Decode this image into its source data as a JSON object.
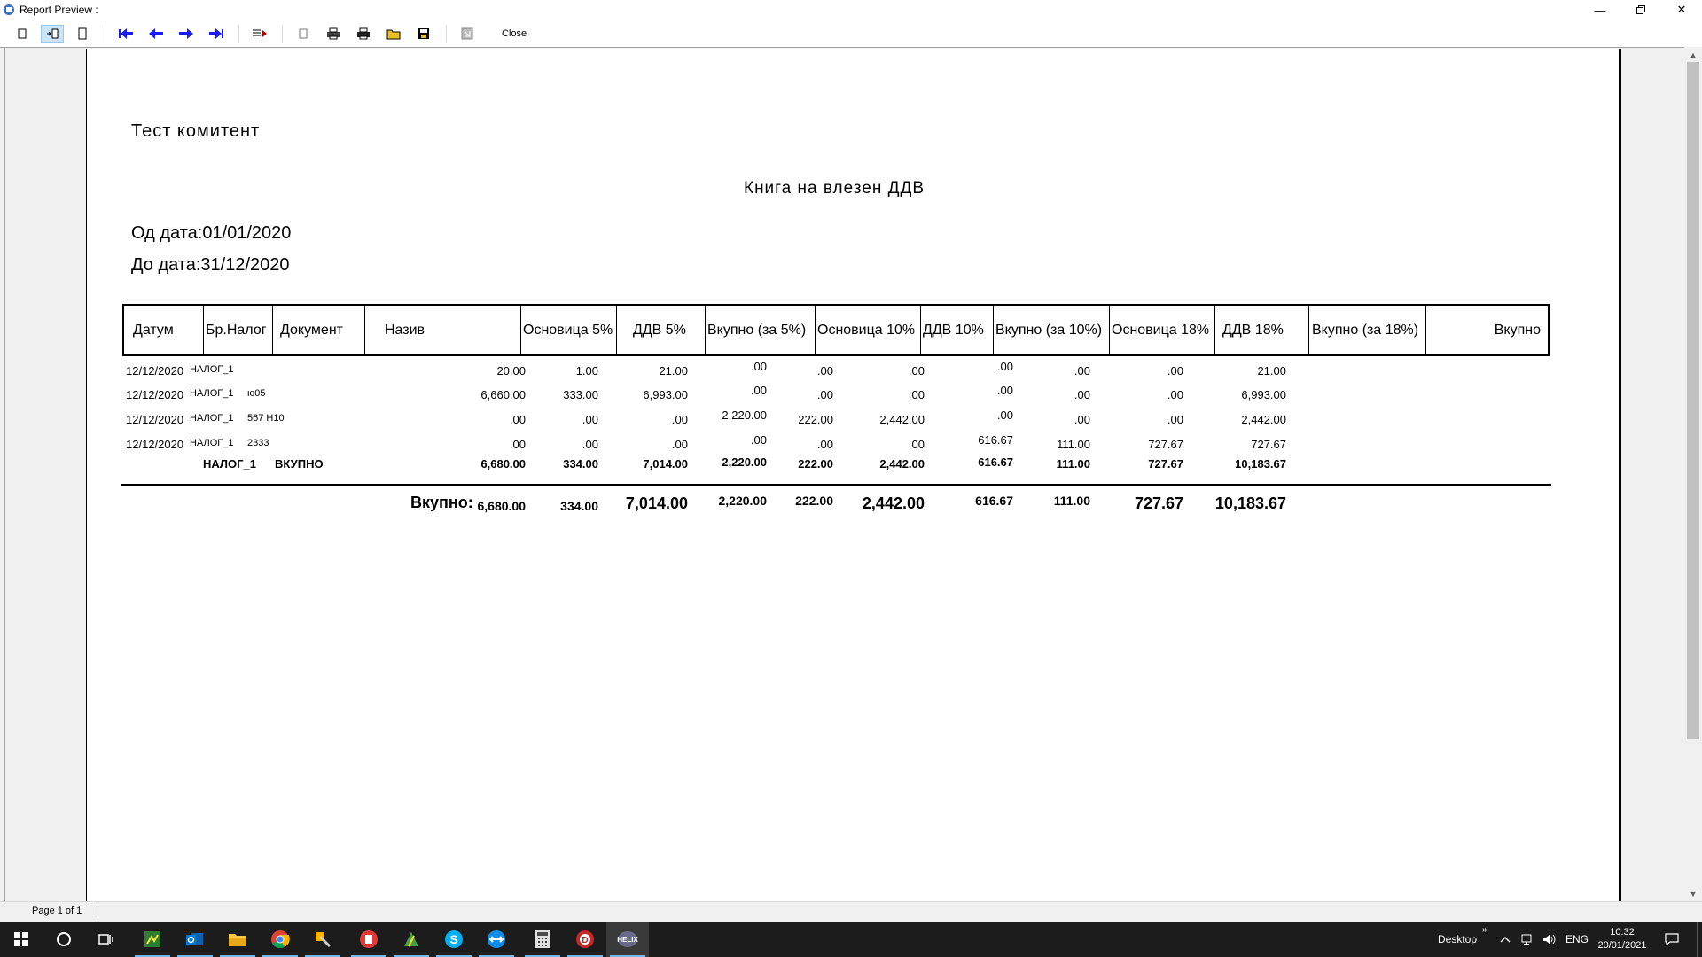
{
  "window": {
    "title": "Report Preview :"
  },
  "toolbar": {
    "close_label": "Close"
  },
  "report": {
    "company": "Тест комитент",
    "title": "Книга на влезен ДДВ",
    "date_from_label": "Од дата:",
    "date_from": "01/01/2020",
    "date_to_label": "До дата:",
    "date_to": "31/12/2020",
    "columns": [
      "Датум",
      "Бр.Налог",
      "Документ",
      "Назив",
      "Основица 5%",
      "ДДВ 5%",
      "Вкупно (за 5%)",
      "Основица 10%",
      "ДДВ 10%",
      "Вкупно (за 10%)",
      "Основица 18%",
      "ДДВ 18%",
      "Вкупно (за 18%)",
      "Вкупно"
    ],
    "rows": [
      [
        "12/12/2020",
        "НАЛОГ_1",
        "",
        "",
        "20.00",
        "1.00",
        "21.00",
        ".00",
        ".00",
        ".00",
        ".00",
        ".00",
        ".00",
        "21.00"
      ],
      [
        "12/12/2020",
        "НАЛОГ_1",
        "ю05",
        "",
        "6,660.00",
        "333.00",
        "6,993.00",
        ".00",
        ".00",
        ".00",
        ".00",
        ".00",
        ".00",
        "6,993.00"
      ],
      [
        "12/12/2020",
        "НАЛОГ_1",
        "567 Н10",
        "",
        ".00",
        ".00",
        ".00",
        "2,220.00",
        "222.00",
        "2,442.00",
        ".00",
        ".00",
        ".00",
        "2,442.00"
      ],
      [
        "12/12/2020",
        "НАЛОГ_1",
        "2333",
        "",
        ".00",
        ".00",
        ".00",
        ".00",
        ".00",
        ".00",
        "616.67",
        "111.00",
        "727.67",
        "727.67"
      ]
    ],
    "subtotal": {
      "nalog": "НАЛОГ_1",
      "label": "ВКУПНО",
      "values": [
        "6,680.00",
        "334.00",
        "7,014.00",
        "2,220.00",
        "222.00",
        "2,442.00",
        "616.67",
        "111.00",
        "727.67",
        "10,183.67"
      ]
    },
    "grand_total": {
      "label": "Вкупно:",
      "values": [
        "6,680.00",
        "334.00",
        "7,014.00",
        "2,220.00",
        "222.00",
        "2,442.00",
        "616.67",
        "111.00",
        "727.67",
        "10,183.67"
      ]
    }
  },
  "statusbar": {
    "page": "Page 1 of 1"
  },
  "taskbar": {
    "desktop": "Desktop",
    "lang": "ENG",
    "time": "10:32",
    "date": "20/01/2021"
  },
  "colors": {
    "accent": "#76b9ed",
    "taskbar": "#1c1c1c",
    "nav_arrows": "#1a1aff"
  }
}
